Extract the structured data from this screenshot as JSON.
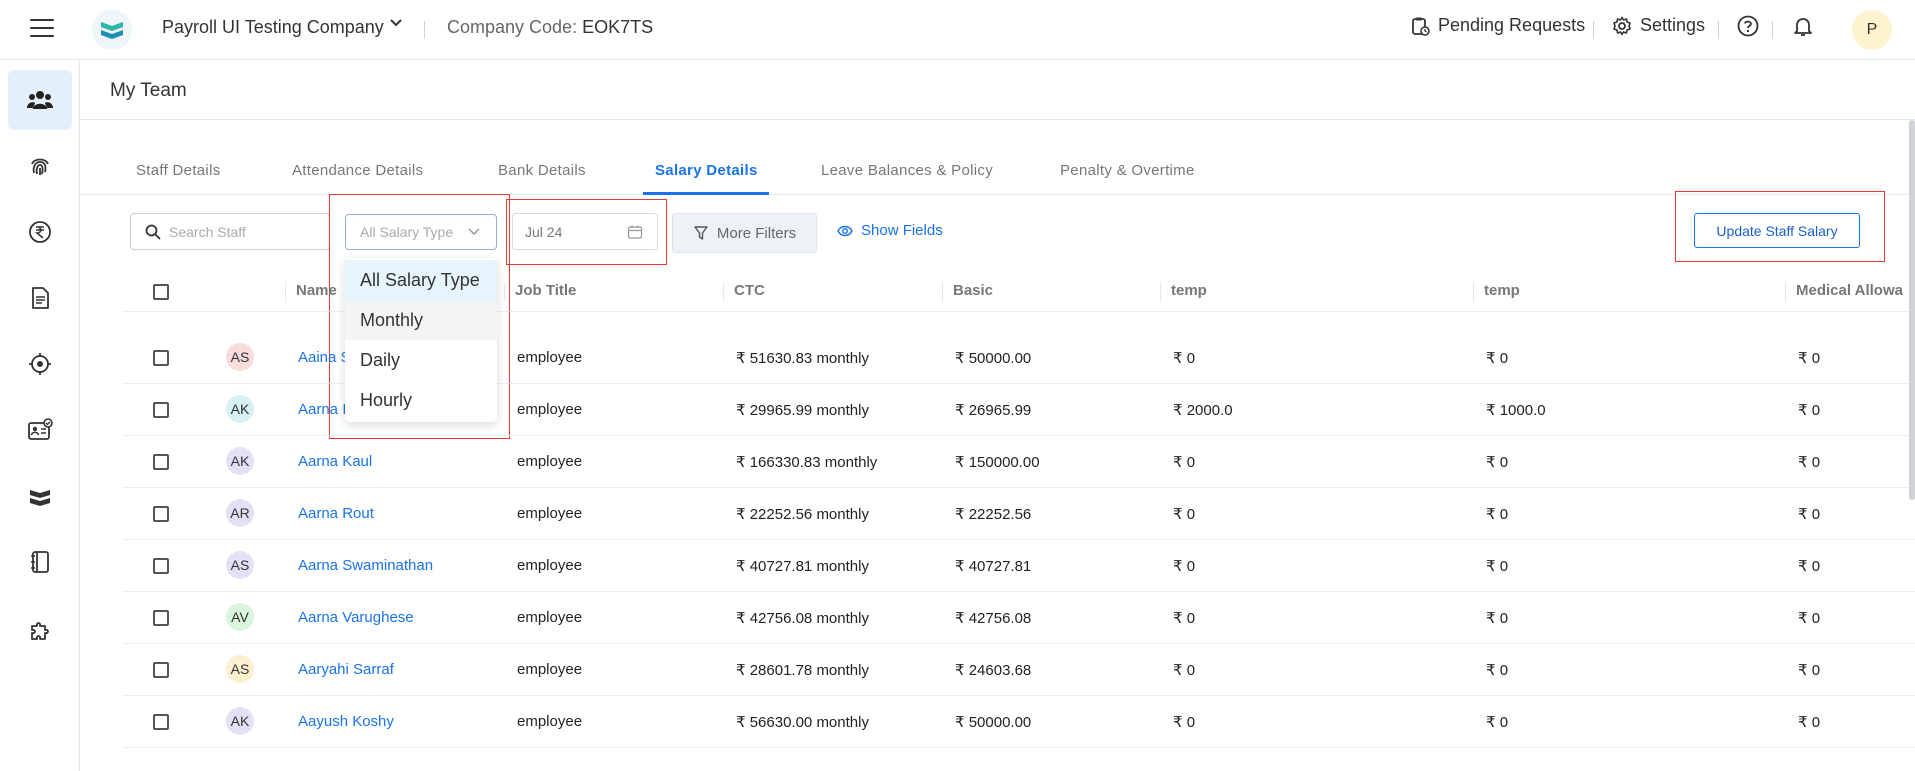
{
  "header": {
    "company_name": "Payroll UI Testing Company",
    "company_code_label": "Company Code:",
    "company_code": "EOK7TS",
    "pending_requests": "Pending Requests",
    "settings": "Settings",
    "avatar_initial": "P"
  },
  "sidebar": {
    "items": [
      "team-icon",
      "fingerprint-icon",
      "rupee-icon",
      "document-icon",
      "target-icon",
      "id-card-icon",
      "book-icon",
      "ledger-icon",
      "puzzle-icon"
    ]
  },
  "page": {
    "title": "My Team"
  },
  "tabs": [
    {
      "label": "Staff Details"
    },
    {
      "label": "Attendance Details"
    },
    {
      "label": "Bank Details"
    },
    {
      "label": "Salary Details"
    },
    {
      "label": "Leave Balances & Policy"
    },
    {
      "label": "Penalty & Overtime"
    }
  ],
  "toolbar": {
    "search_placeholder": "Search Staff",
    "salary_type_placeholder": "All Salary Type",
    "date_value": "Jul 24",
    "more_filters": "More Filters",
    "show_fields": "Show Fields",
    "update_staff_salary": "Update Staff Salary"
  },
  "dropdown": {
    "options": [
      "All Salary Type",
      "Monthly",
      "Daily",
      "Hourly"
    ],
    "selected": "All Salary Type",
    "hovered": "Monthly"
  },
  "table": {
    "columns": [
      "Name",
      "Job Title",
      "CTC",
      "Basic",
      "temp",
      "temp",
      "Medical Allowa"
    ],
    "rows": [
      {
        "initials": "AS",
        "avatar_color": "#fbdcdc",
        "name": "Aaina S",
        "job": "employee",
        "ctc": "₹ 51630.83 monthly",
        "basic": "₹ 50000.00",
        "temp1": "₹ 0",
        "temp2": "₹ 0",
        "medical": "₹ 0"
      },
      {
        "initials": "AK",
        "avatar_color": "#d7f0f3",
        "name": "Aarna I",
        "job": "employee",
        "ctc": "₹ 29965.99 monthly",
        "basic": "₹ 26965.99",
        "temp1": "₹ 2000.0",
        "temp2": "₹ 1000.0",
        "medical": "₹ 0"
      },
      {
        "initials": "AK",
        "avatar_color": "#e4e1f7",
        "name": "Aarna Kaul",
        "job": "employee",
        "ctc": "₹ 166330.83 monthly",
        "basic": "₹ 150000.00",
        "temp1": "₹ 0",
        "temp2": "₹ 0",
        "medical": "₹ 0"
      },
      {
        "initials": "AR",
        "avatar_color": "#e4e1f7",
        "name": "Aarna Rout",
        "job": "employee",
        "ctc": "₹ 22252.56 monthly",
        "basic": "₹ 22252.56",
        "temp1": "₹ 0",
        "temp2": "₹ 0",
        "medical": "₹ 0"
      },
      {
        "initials": "AS",
        "avatar_color": "#e4e1f7",
        "name": "Aarna Swaminathan",
        "job": "employee",
        "ctc": "₹ 40727.81 monthly",
        "basic": "₹ 40727.81",
        "temp1": "₹ 0",
        "temp2": "₹ 0",
        "medical": "₹ 0"
      },
      {
        "initials": "AV",
        "avatar_color": "#d9f5dc",
        "name": "Aarna Varughese",
        "job": "employee",
        "ctc": "₹ 42756.08 monthly",
        "basic": "₹ 42756.08",
        "temp1": "₹ 0",
        "temp2": "₹ 0",
        "medical": "₹ 0"
      },
      {
        "initials": "AS",
        "avatar_color": "#fdf0cf",
        "name": "Aaryahi Sarraf",
        "job": "employee",
        "ctc": "₹ 28601.78 monthly",
        "basic": "₹ 24603.68",
        "temp1": "₹ 0",
        "temp2": "₹ 0",
        "medical": "₹ 0"
      },
      {
        "initials": "AK",
        "avatar_color": "#e4e1f7",
        "name": "Aayush Koshy",
        "job": "employee",
        "ctc": "₹ 56630.00 monthly",
        "basic": "₹ 50000.00",
        "temp1": "₹ 0",
        "temp2": "₹ 0",
        "medical": "₹ 0"
      }
    ]
  }
}
